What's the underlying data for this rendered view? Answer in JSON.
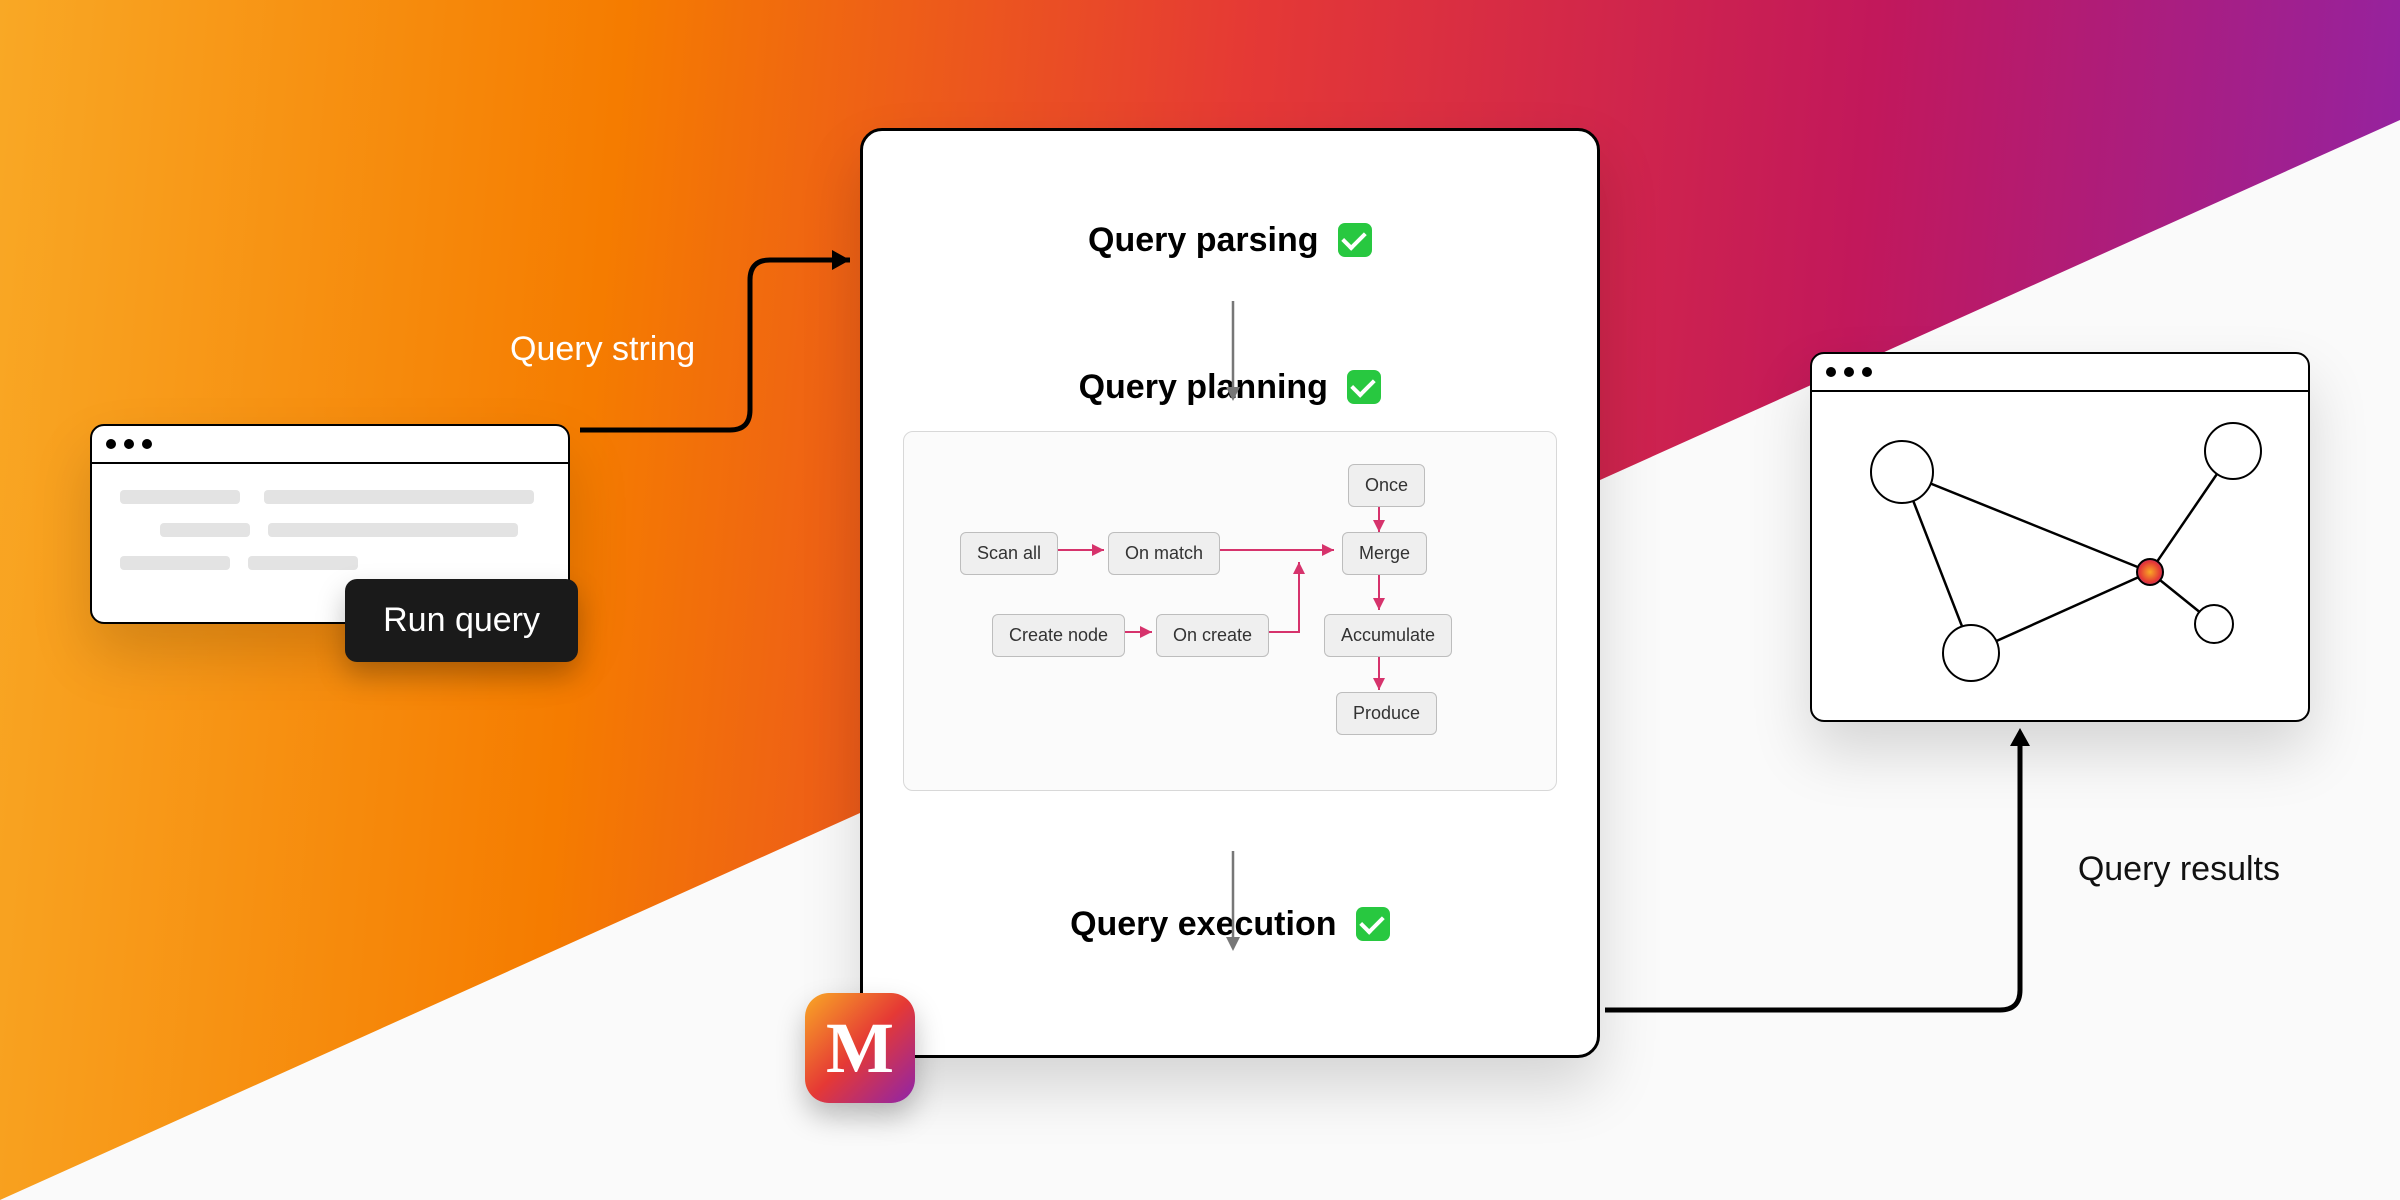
{
  "labels": {
    "query_string": "Query string",
    "query_results": "Query results",
    "run_query": "Run query"
  },
  "stages": {
    "parsing": "Query parsing",
    "planning": "Query planning",
    "execution": "Query execution"
  },
  "plan_nodes": {
    "scan_all": "Scan all",
    "on_match": "On match",
    "create_node": "Create node",
    "on_create": "On create",
    "once": "Once",
    "merge": "Merge",
    "accumulate": "Accumulate",
    "produce": "Produce"
  },
  "logo_letter": "M"
}
